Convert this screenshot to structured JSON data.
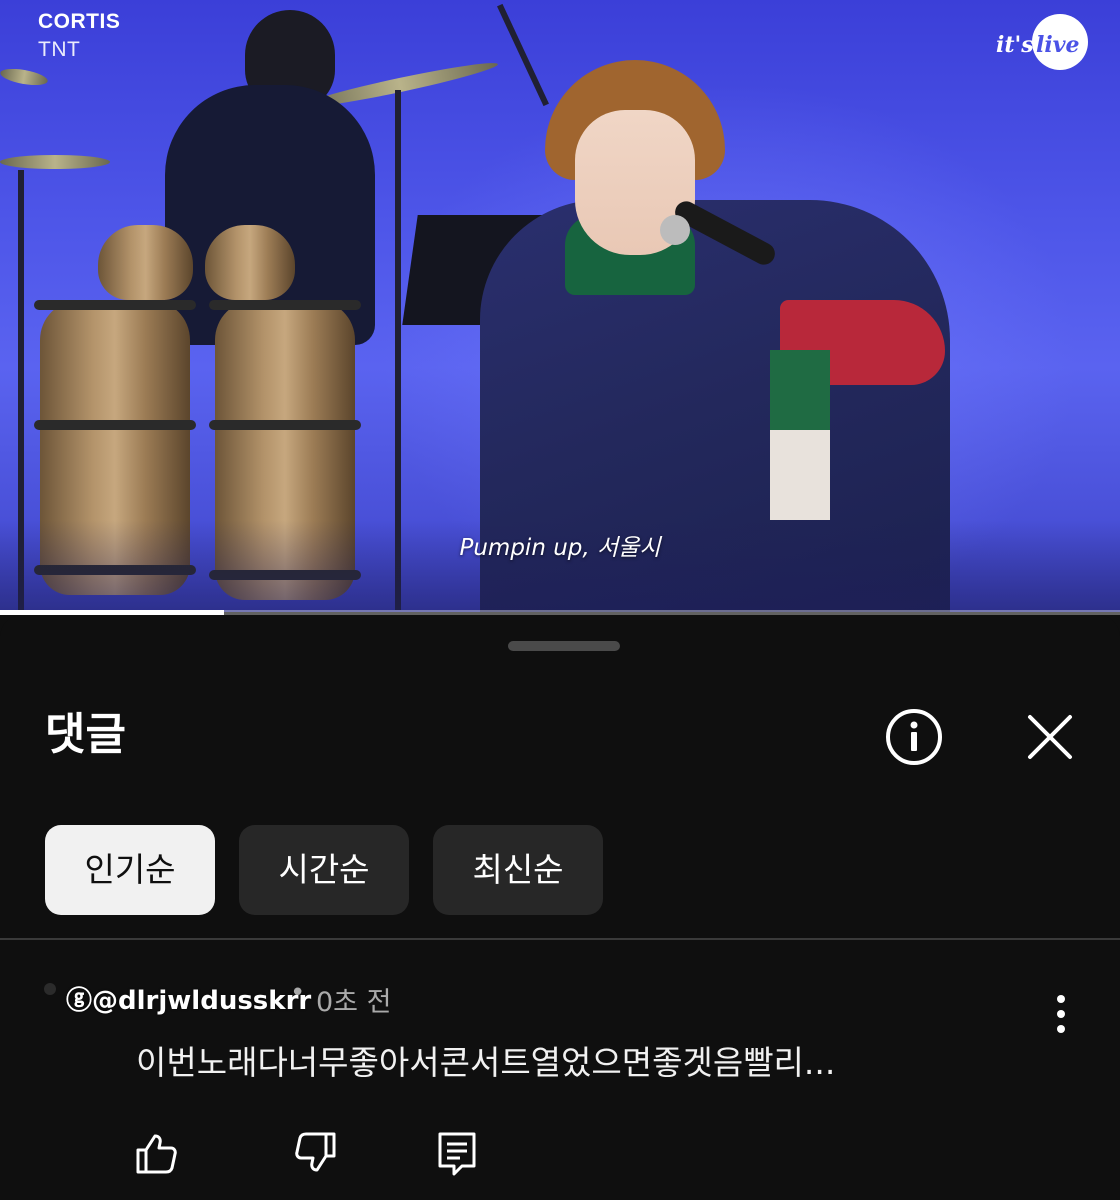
{
  "video": {
    "channel": "CORTIS",
    "track": "TNT",
    "logo_its": "it's",
    "logo_live": "live",
    "subtitle": "Pumpin up, 서울시",
    "progress_fraction": 0.2
  },
  "comments_sheet": {
    "title": "댓글",
    "info_icon": "info-circle-icon",
    "close_icon": "close-icon",
    "sort_chips": [
      {
        "label": "인기순",
        "active": true
      },
      {
        "label": "시간순",
        "active": false
      },
      {
        "label": "최신순",
        "active": false
      }
    ],
    "comments": [
      {
        "author": "@dlrjwldusskrr",
        "time": "0초 전",
        "text": "이번노래다너무좋아서콘서트열었으면좋겟음빨리...",
        "actions": [
          "thumb-up-icon",
          "thumb-down-icon",
          "reply-icon"
        ]
      }
    ]
  },
  "colors": {
    "sheet_background": "#0f0f0f",
    "chip_active": "#f1f1f1",
    "chip_inactive": "#272727",
    "video_background": "#4d55e8"
  }
}
